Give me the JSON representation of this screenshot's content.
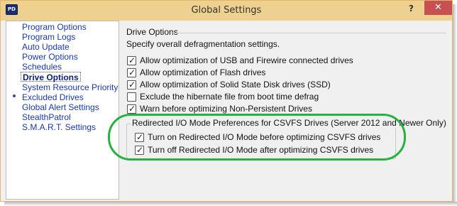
{
  "window": {
    "title": "Global Settings",
    "app_icon_text": "PD",
    "help_label": "?",
    "close_label": "✕"
  },
  "sidebar": {
    "items": [
      {
        "label": "Program Options",
        "selected": false
      },
      {
        "label": "Program Logs",
        "selected": false
      },
      {
        "label": "Auto Update",
        "selected": false
      },
      {
        "label": "Power Options",
        "selected": false
      },
      {
        "label": "Schedules",
        "selected": false
      },
      {
        "label": "Drive Options",
        "selected": true
      },
      {
        "label": "System Resource Priority",
        "selected": false
      },
      {
        "label": "Excluded Drives",
        "selected": false
      },
      {
        "label": "Global Alert Settings",
        "selected": false
      },
      {
        "label": "StealthPatrol",
        "selected": false
      },
      {
        "label": "S.M.A.R.T. Settings",
        "selected": false
      }
    ]
  },
  "panel": {
    "group_title": "Drive Options",
    "description": "Specify overall defragmentation settings.",
    "options": [
      {
        "label": "Allow optimization of USB and Firewire connected drives",
        "checked": true
      },
      {
        "label": "Allow optimization of Flash drives",
        "checked": true
      },
      {
        "label": "Allow optimization of Solid State Disk drives (SSD)",
        "checked": true
      },
      {
        "label": "Exclude the hibernate file from boot time defrag",
        "checked": false
      },
      {
        "label": "Warn before optimizing Non-Persistent Drives",
        "checked": true
      }
    ],
    "redirected": {
      "title": "Redirected I/O Mode Preferences for CSVFS Drives (Server 2012 and Newer Only)",
      "options": [
        {
          "label": "Turn on Redirected I/O Mode before optimizing CSVFS drives",
          "checked": true
        },
        {
          "label": "Turn off Redirected I/O Mode after optimizing CSVFS drives",
          "checked": true
        }
      ]
    }
  },
  "colors": {
    "titlebar": "#eed08f",
    "close_button": "#c75050",
    "nav_link": "#1a38a8",
    "highlight": "#27b13e"
  }
}
